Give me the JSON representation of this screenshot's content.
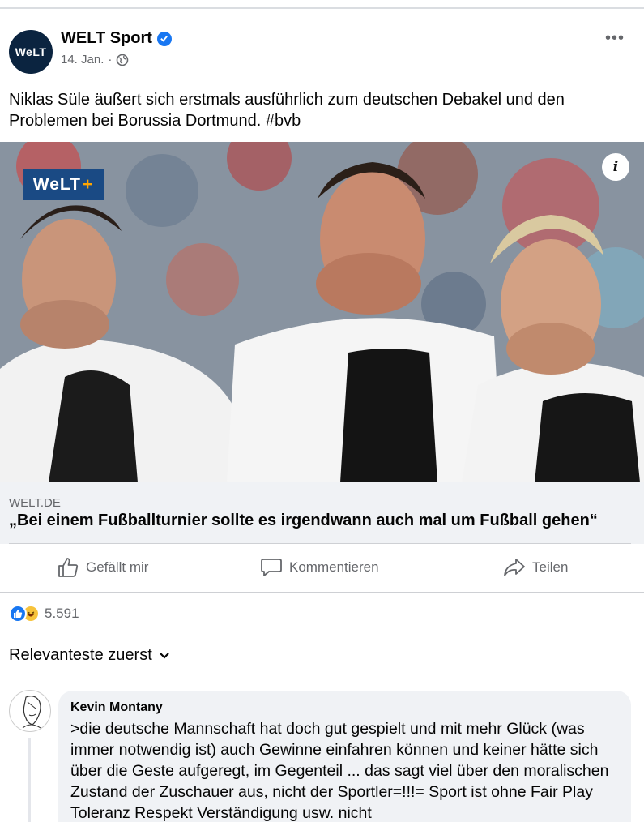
{
  "post": {
    "author": "WELT Sport",
    "avatar_text": "WeLT",
    "date": "14. Jan.",
    "visibility_icon": "globe-icon",
    "more_icon": "more-options-icon",
    "text": "Niklas Süle äußert sich erstmals ausführlich zum deutschen Debakel und den Problemen bei Borussia Dortmund. #bvb"
  },
  "image": {
    "badge_main": "WeLT",
    "badge_plus": "+",
    "info_icon": "i"
  },
  "link": {
    "domain": "WELT.DE",
    "title": "„Bei einem Fußballturnier sollte es irgendwann auch mal um Fußball gehen“"
  },
  "actions": {
    "like": "Gefällt mir",
    "comment": "Kommentieren",
    "share": "Teilen"
  },
  "reactions": {
    "count": "5.591"
  },
  "sort": {
    "label": "Relevanteste zuerst"
  },
  "comment": {
    "author": "Kevin Montany",
    "text": ">die deutsche Mannschaft hat doch gut gespielt und mit mehr Glück (was immer notwendig ist) auch Gewinne einfahren können und keiner hätte sich über die Geste aufgeregt, im Gegenteil ... das sagt viel über den moralischen Zustand der Zuschauer aus, nicht der Sportler=!!!= Sport ist ohne Fair Play Toleranz Respekt Verständigung usw. nicht"
  },
  "colors": {
    "accent": "#1877f2",
    "muted": "#65676b",
    "bubble": "#f0f2f5",
    "welt_blue": "#1a4a84"
  }
}
